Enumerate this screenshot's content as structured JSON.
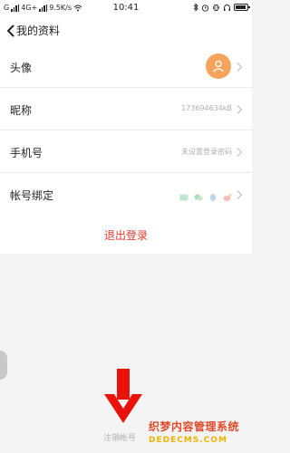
{
  "status_bar": {
    "network_left": "G",
    "network_type": "4G+",
    "speed": "9.5K/s",
    "time": "10:41"
  },
  "header": {
    "title": "我的资料"
  },
  "profile": {
    "rows": [
      {
        "label": "头像",
        "value": ""
      },
      {
        "label": "昵称",
        "value": "173694634kB"
      },
      {
        "label": "手机号",
        "value": "未设置登录密码"
      },
      {
        "label": "帐号绑定",
        "value": ""
      }
    ],
    "bind_icons": [
      "message-icon",
      "wechat-icon",
      "qq-icon",
      "weibo-icon"
    ],
    "avatar_color": "#f6a35b"
  },
  "logout": {
    "label": "退出登录",
    "color": "#e23a2e"
  },
  "cancel_account": {
    "label": "注销帐号"
  },
  "annotation_arrow": {
    "color": "#e8120b"
  },
  "watermark": {
    "line1": "织梦内容管理系统",
    "line2": "DEDECMS.COM"
  }
}
